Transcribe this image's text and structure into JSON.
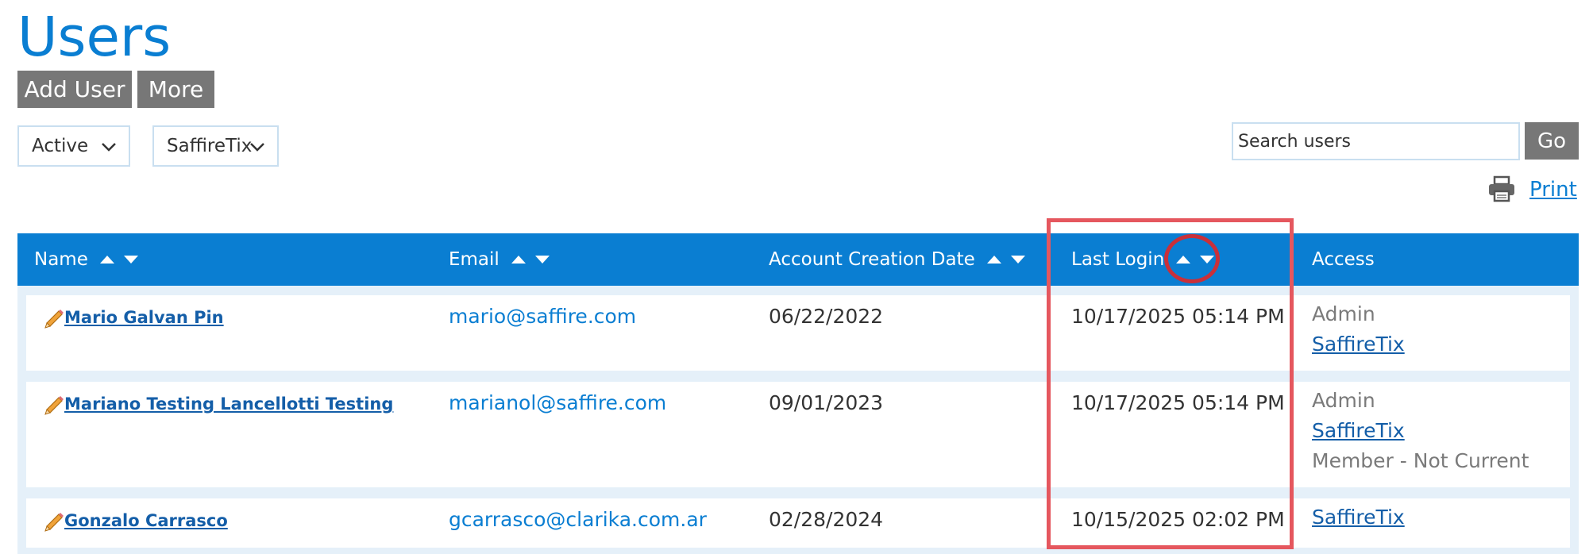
{
  "page": {
    "title": "Users"
  },
  "toolbar": {
    "add_user_label": "Add User",
    "more_label": "More"
  },
  "filters": {
    "status": {
      "selected": "Active"
    },
    "organization": {
      "selected": "SaffireTix"
    }
  },
  "search": {
    "placeholder": "Search users",
    "value": "",
    "go_label": "Go"
  },
  "print": {
    "label": "Print",
    "icon": "printer-icon"
  },
  "colors": {
    "accent": "#0a7ed2",
    "highlight": "#e5575e",
    "button": "#777777"
  },
  "table": {
    "columns": [
      {
        "label": "Name",
        "sortable": true
      },
      {
        "label": "Email",
        "sortable": true
      },
      {
        "label": "Account Creation Date",
        "sortable": true
      },
      {
        "label": "Last Login",
        "sortable": true
      },
      {
        "label": "Access",
        "sortable": false
      }
    ],
    "rows": [
      {
        "name": "Mario Galvan Pin",
        "email": "mario@saffire.com",
        "created": "06/22/2022",
        "last_login": "10/17/2025 05:14 PM",
        "access": [
          {
            "text": "Admin",
            "link": false
          },
          {
            "text": "SaffireTix",
            "link": true
          }
        ]
      },
      {
        "name": "Mariano Testing Lancellotti Testing",
        "email": "marianol@saffire.com",
        "created": "09/01/2023",
        "last_login": "10/17/2025 05:14 PM",
        "access": [
          {
            "text": "Admin",
            "link": false
          },
          {
            "text": "SaffireTix",
            "link": true
          },
          {
            "text": "Member - Not Current",
            "link": false
          }
        ]
      },
      {
        "name": "Gonzalo Carrasco",
        "email": "gcarrasco@clarika.com.ar",
        "created": "02/28/2024",
        "last_login": "10/15/2025 02:02 PM",
        "access": [
          {
            "text": "SaffireTix",
            "link": true
          }
        ]
      }
    ]
  }
}
